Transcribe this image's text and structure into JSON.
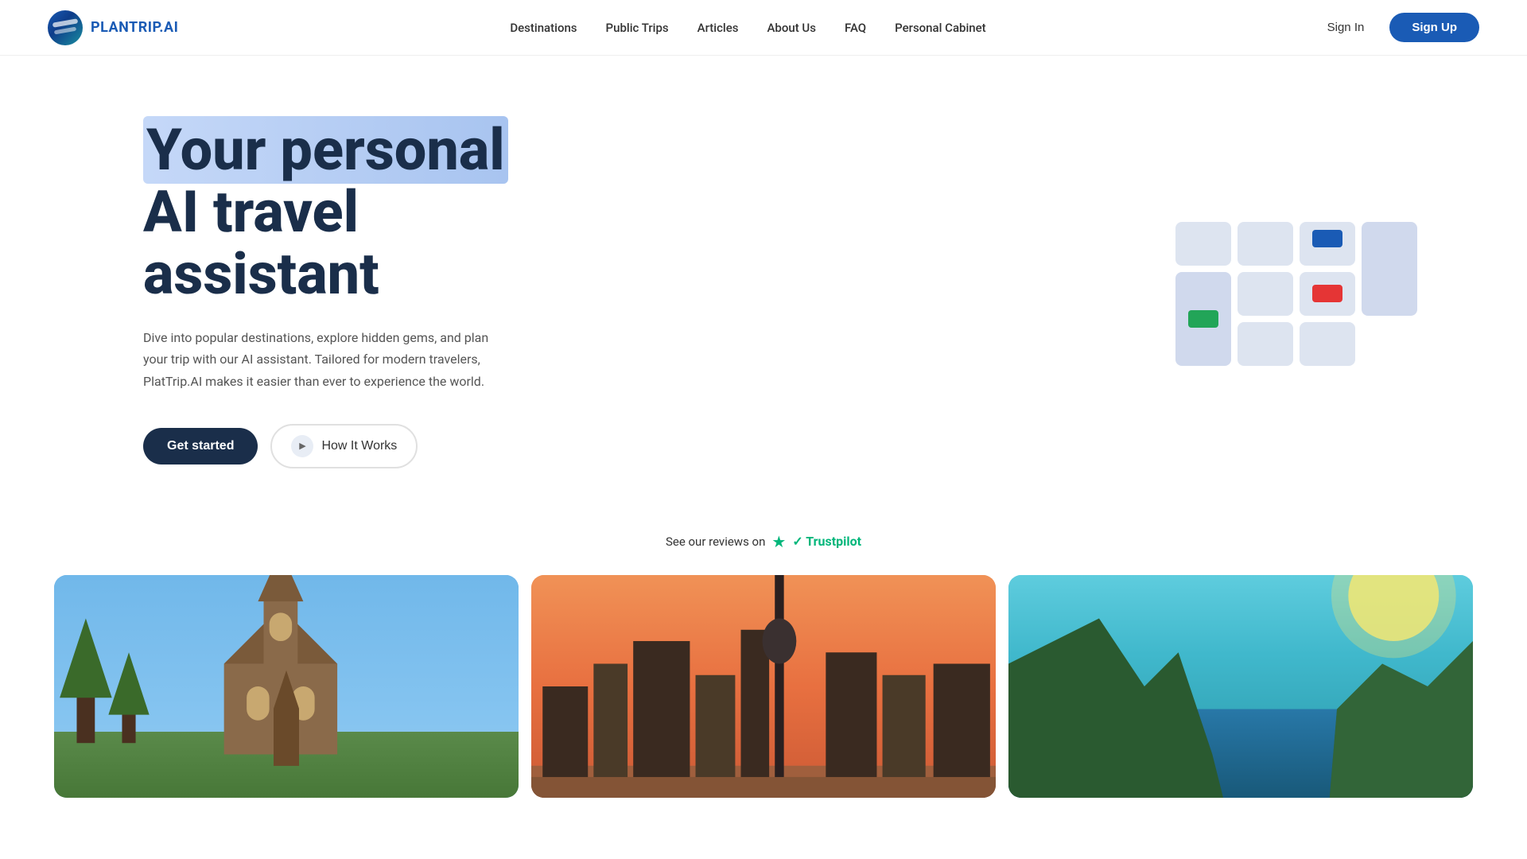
{
  "logo": {
    "text": "PLANTRIP",
    "suffix": ".AI"
  },
  "navbar": {
    "links": [
      {
        "label": "Destinations",
        "href": "#"
      },
      {
        "label": "Public Trips",
        "href": "#"
      },
      {
        "label": "Articles",
        "href": "#"
      },
      {
        "label": "About Us",
        "href": "#"
      },
      {
        "label": "FAQ",
        "href": "#"
      },
      {
        "label": "Personal Cabinet",
        "href": "#"
      }
    ],
    "sign_in": "Sign In",
    "sign_up": "Sign Up"
  },
  "hero": {
    "title_line1": "Your personal",
    "title_line2": "AI travel",
    "title_line3": "assistant",
    "description": "Dive into popular destinations, explore hidden gems, and plan your trip with our AI assistant. Tailored for modern travelers, PlatTrip.AI makes it easier than ever to experience the world.",
    "get_started": "Get started",
    "how_it_works": "How It Works"
  },
  "trustpilot": {
    "text": "See our reviews on",
    "brand": "Trustpilot",
    "star": "★"
  },
  "destinations": [
    {
      "id": "dest-1",
      "theme": "church"
    },
    {
      "id": "dest-2",
      "theme": "city"
    },
    {
      "id": "dest-3",
      "theme": "cliff"
    }
  ],
  "colors": {
    "primary": "#1a5bb5",
    "dark": "#1a2e4a",
    "trustpilot_green": "#00b67a"
  }
}
